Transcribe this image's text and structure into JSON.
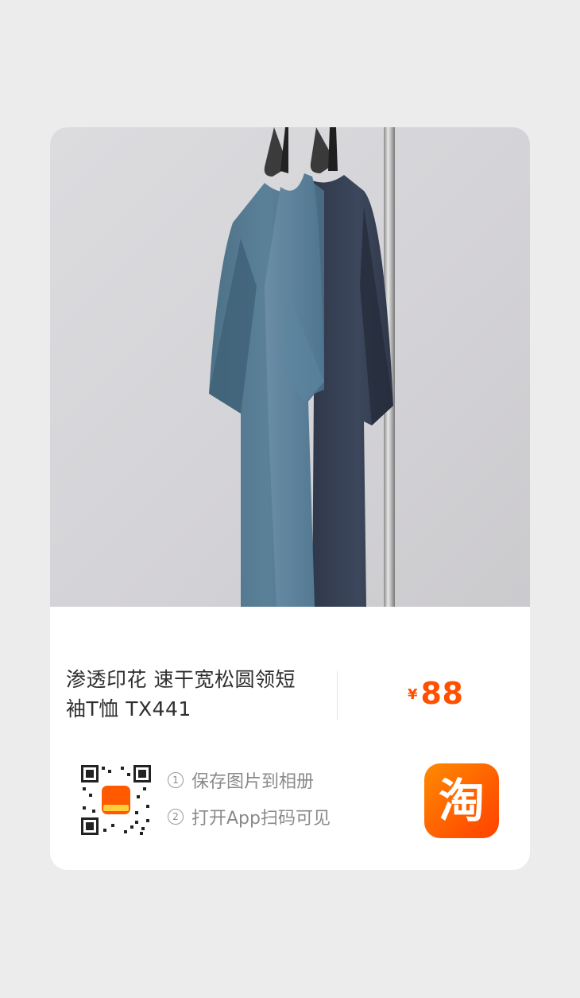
{
  "product": {
    "title_line1": "渗透印花 速干宽松圆领短",
    "title_line2": "袖T恤 TX441",
    "currency": "¥",
    "price": "88"
  },
  "share": {
    "step1_num": "1",
    "step1_text": "保存图片到相册",
    "step2_num": "2",
    "step2_text": "打开App扫码可见",
    "qr_center_icon": "淘",
    "app_logo_glyph": "淘"
  },
  "colors": {
    "price": "#ff5000",
    "brand": "#ff5500"
  }
}
